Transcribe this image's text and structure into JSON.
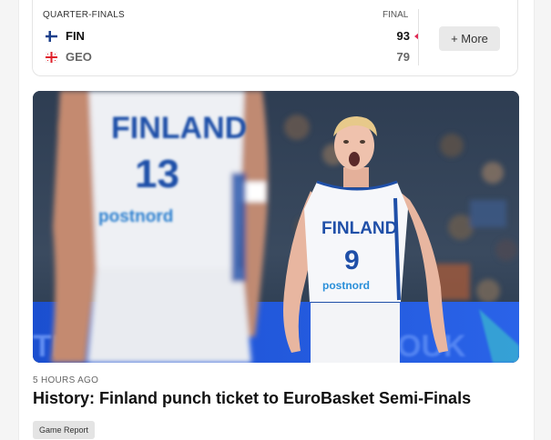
{
  "score_card": {
    "round": "QUARTER-FINALS",
    "status": "FINAL",
    "teams": [
      {
        "code": "FIN",
        "score": "93",
        "flag": "finland-flag",
        "winner": true
      },
      {
        "code": "GEO",
        "score": "79",
        "flag": "georgia-flag",
        "winner": false
      }
    ],
    "more_label": "+ More",
    "winner_color": "#e02a55"
  },
  "article": {
    "image": {
      "jersey_front": "FINLAND",
      "jersey_front_number": "13",
      "jersey_main": "FINLAND",
      "jersey_main_number": "9",
      "sponsor": "postnord"
    },
    "timestamp": "5 HOURS AGO",
    "headline": "History: Finland punch ticket to EuroBasket Semi-Finals",
    "tag": "Game Report"
  },
  "colors": {
    "jersey_blue": "#1f4fa8",
    "accent_pink": "#e02a55"
  }
}
